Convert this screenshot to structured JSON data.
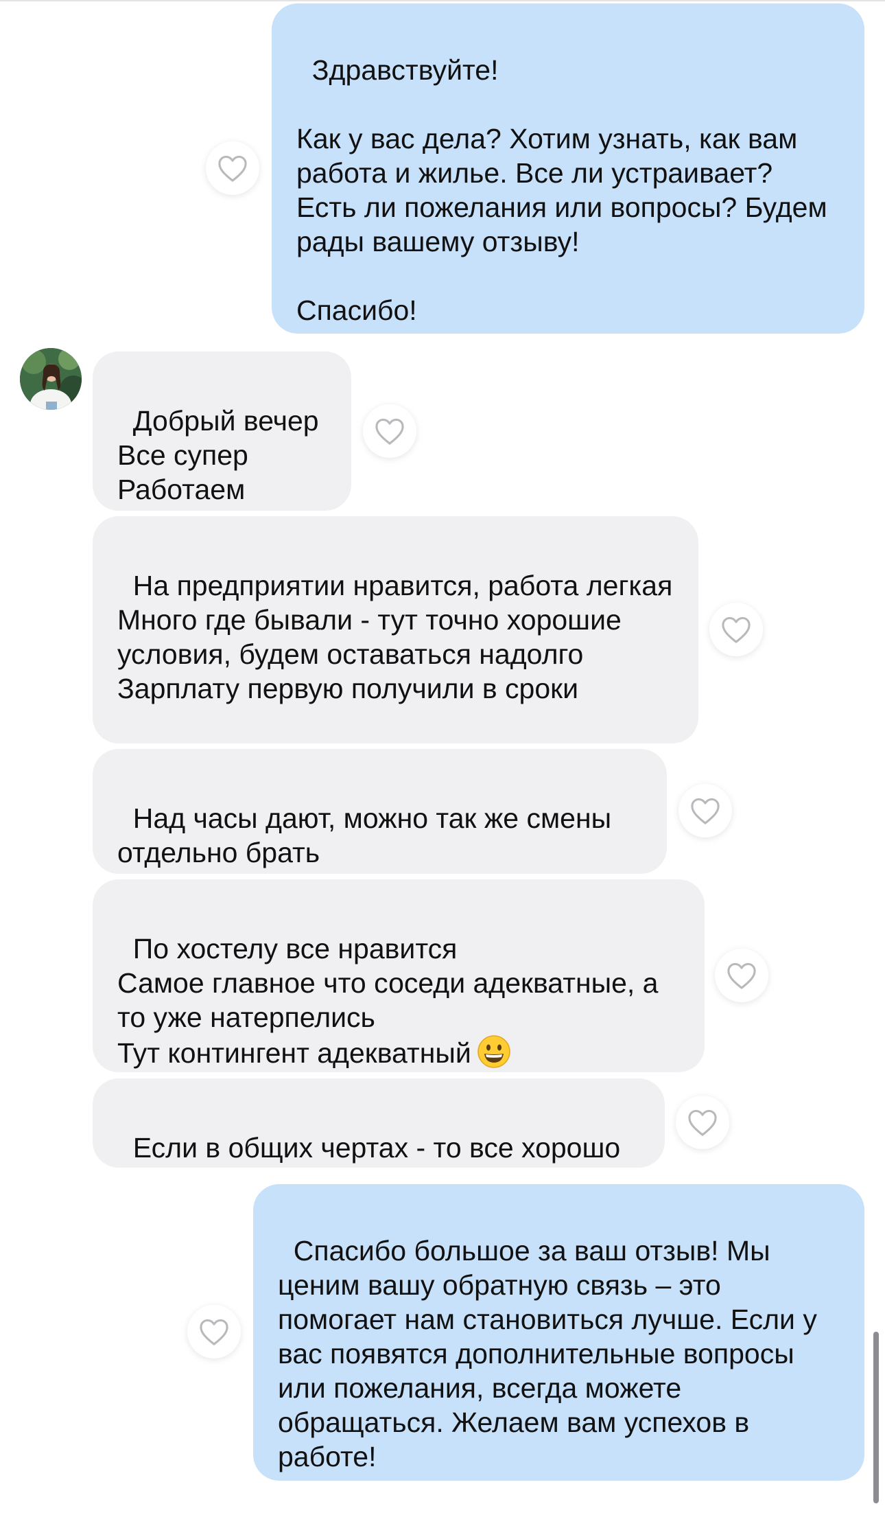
{
  "messages": [
    {
      "id": "m1",
      "direction": "outgoing",
      "text": "Здравствуйте!\n\nКак у вас дела? Хотим узнать, как вам работа и жилье. Все ли устраивает? Есть ли пожелания или вопросы? Будем рады вашему отзыву!\n\nСпасибо!"
    },
    {
      "id": "m2",
      "direction": "incoming",
      "text": "Добрый вечер\nВсе супер\nРаботаем"
    },
    {
      "id": "m3",
      "direction": "incoming",
      "text": "На предприятии нравится, работа легкая\nМного где бывали - тут точно хорошие условия, будем оставаться надолго\nЗарплату первую получили в сроки"
    },
    {
      "id": "m4",
      "direction": "incoming",
      "text": "Над часы дают, можно так же смены отдельно брать"
    },
    {
      "id": "m5",
      "direction": "incoming",
      "text": "По хостелу все нравится\nСамое главное что соседи адекватные, а то уже натерпелись\nТут контингент адекватный",
      "emoji": "grinning-face"
    },
    {
      "id": "m6",
      "direction": "incoming",
      "text": "Если в общих чертах - то все хорошо"
    },
    {
      "id": "m7",
      "direction": "outgoing",
      "text": "Спасибо большое за ваш отзыв! Мы ценим вашу обратную связь – это помогает нам становиться лучше. Если у вас появятся дополнительные вопросы или пожелания, всегда можете обращаться. Желаем вам успехов в работе!"
    }
  ],
  "colors": {
    "outgoing_bubble": "#c8e1fb",
    "incoming_bubble": "#f0f0f2",
    "text": "#111111",
    "heart_outline": "#b8b8bd"
  },
  "icons": {
    "like": "heart-outline-icon",
    "avatar": "user-avatar-photo"
  }
}
